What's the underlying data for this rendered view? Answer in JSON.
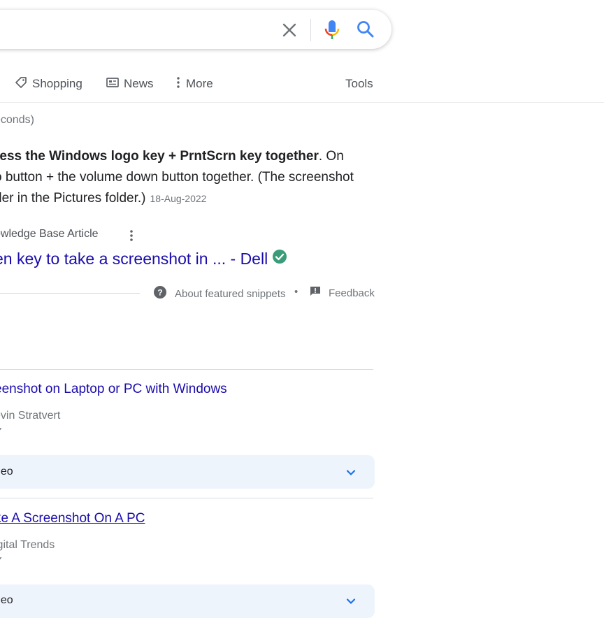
{
  "search": {
    "value": "",
    "clear_icon": "close-icon",
    "mic_icon": "mic-icon",
    "search_icon": "search-icon"
  },
  "tabs": [
    {
      "label": "Shopping",
      "icon": "tag-icon"
    },
    {
      "label": "News",
      "icon": "newspaper-icon"
    },
    {
      "label": "More",
      "icon": "more-vert-icon"
    }
  ],
  "tools_label": "Tools",
  "result_stats": "econds)",
  "snippet": {
    "line1_bold": "ress the Windows logo key + PrntScrn key together",
    "line1_rest": ". On",
    "line2": "o button + the volume down button together. (The screenshot",
    "line3": "der in the Pictures folder.)",
    "date": "18-Aug-2022",
    "source": "owledge Base Article",
    "link_title": "en key to take a screenshot in ... - Dell",
    "about_label": "About featured snippets",
    "bullet": "•",
    "feedback_label": "Feedback"
  },
  "results": [
    {
      "title": "eenshot on Laptop or PC with Windows",
      "source": "evin Stratvert",
      "tiny": "Y",
      "video_label": "deo"
    },
    {
      "title": "ke A Screenshot On A PC",
      "source": "igital Trends",
      "tiny": "Y",
      "video_label": "deo"
    }
  ],
  "colors": {
    "link": "#1a0dab",
    "accent_blue": "#1a73e8",
    "verified_green": "#34a853"
  }
}
